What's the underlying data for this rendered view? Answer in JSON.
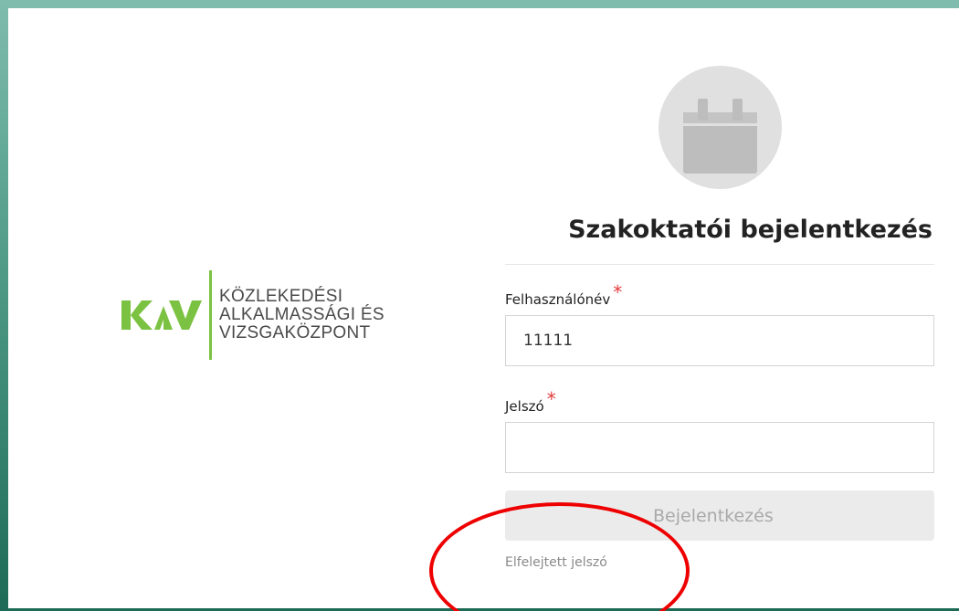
{
  "brand": {
    "logo_letters": "KAV",
    "name_lines": [
      "KÖZLEKEDÉSI",
      "ALKALMASSÁGI ÉS",
      "VIZSGAKÖZPONT"
    ],
    "green": "#7cc242"
  },
  "login": {
    "avatar_icon": "calendar-icon",
    "title": "Szakoktatói bejelentkezés",
    "username_label": "Felhasználónév",
    "username_value": "11111",
    "password_label": "Jelszó",
    "password_value": "",
    "required_mark": "*",
    "submit_label": "Bejelentkezés",
    "forgot_label": "Elfelejtett jelszó"
  },
  "colors": {
    "frame": "#1d6b57",
    "required": "#e23b3b",
    "highlight": "#ee0000"
  }
}
